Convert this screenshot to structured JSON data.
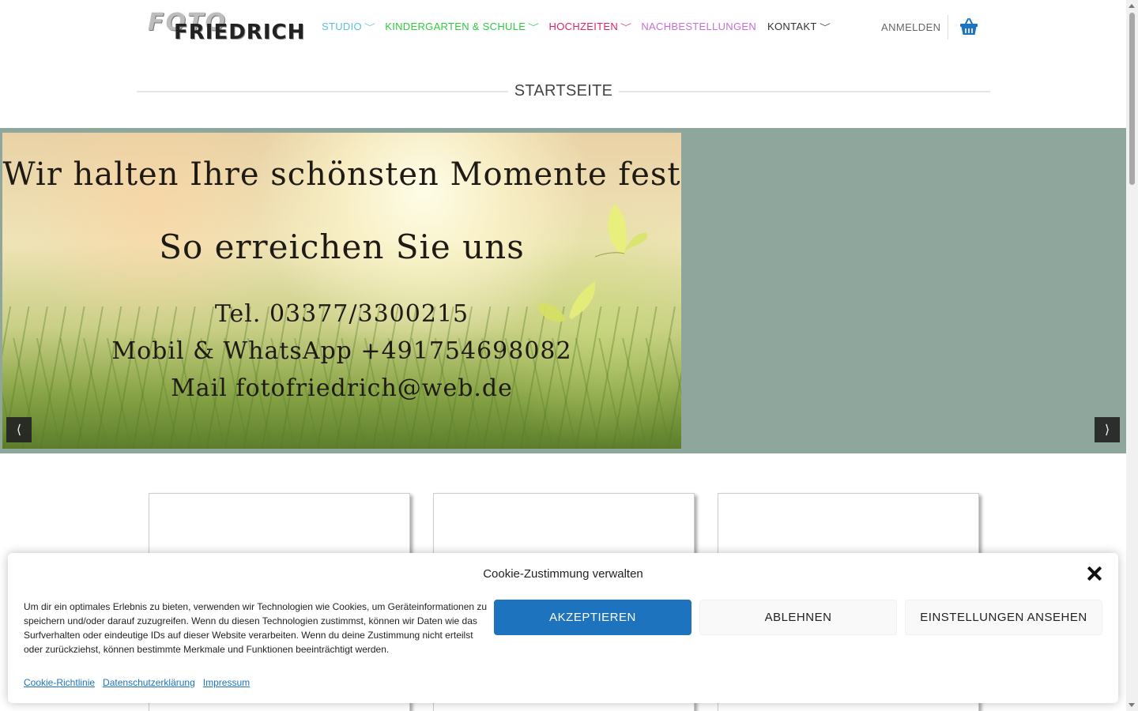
{
  "header": {
    "logo_line1": "FOTO",
    "logo_line2": "FRIEDRICH",
    "nav": [
      {
        "label": "STUDIO",
        "color": "#5bc0de"
      },
      {
        "label": "KINDERGARTEN & SCHULE",
        "color": "#2ecc40"
      },
      {
        "label": "HOCHZEITEN",
        "color": "#e0245e"
      },
      {
        "label": "NACHBESTELLUNGEN",
        "color": "#c86dd7"
      },
      {
        "label": "KONTAKT",
        "color": "#333333"
      }
    ],
    "chevron": "﹀",
    "login": "ANMELDEN",
    "cart_icon": "basket-icon",
    "cart_color": "#1e73be"
  },
  "page": {
    "title": "STARTSEITE"
  },
  "slider": {
    "line1": "Wir halten Ihre schönsten Momente fest",
    "line2": "So erreichen Sie uns",
    "line3": "Tel.  03377/3300215",
    "line4": "Mobil & WhatsApp  +491754698082",
    "line5": "Mail   fotofriedrich@web.de",
    "prev": "⟨",
    "next": "⟩",
    "bg_color": "#8fa69c"
  },
  "cookie": {
    "title": "Cookie-Zustimmung verwalten",
    "text": "Um dir ein optimales Erlebnis zu bieten, verwenden wir Technologien wie Cookies, um Geräteinformationen zu speichern und/oder darauf zuzugreifen. Wenn du diesen Technologien zustimmst, können wir Daten wie das Surfverhalten oder eindeutige IDs auf dieser Website verarbeiten. Wenn du deine Zustimmung nicht erteilst oder zurückziehst, können bestimmte Merkmale und Funktionen beeinträchtigt werden.",
    "accept": "AKZEPTIEREN",
    "deny": "ABLEHNEN",
    "settings": "EINSTELLUNGEN ANSEHEN",
    "links": [
      "Cookie-Richtlinie",
      "Datenschutzerklärung",
      "Impressum"
    ],
    "accent": "#1e73be"
  }
}
